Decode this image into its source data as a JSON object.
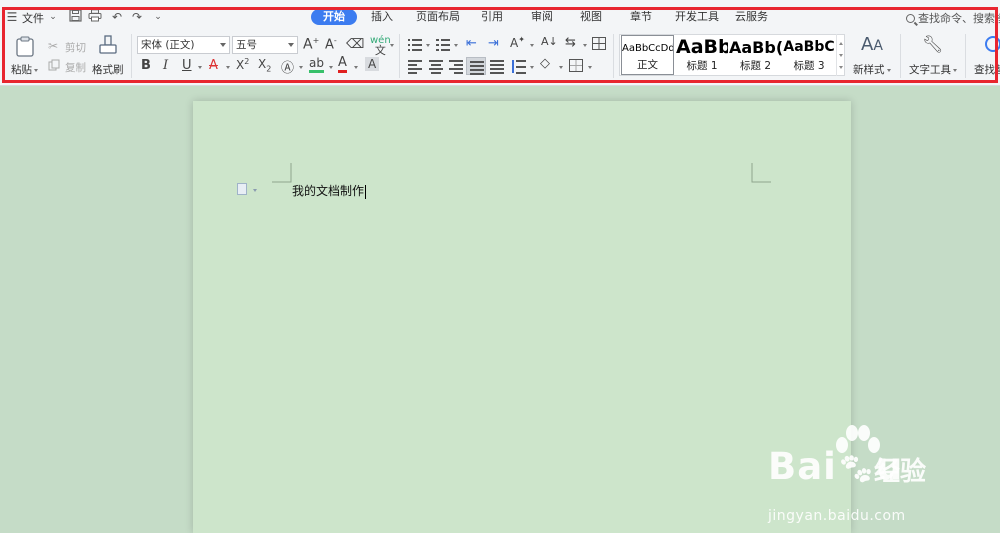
{
  "menu": {
    "file_label": "文件"
  },
  "tabs": [
    {
      "label": "开始",
      "active": true
    },
    {
      "label": "插入"
    },
    {
      "label": "页面布局"
    },
    {
      "label": "引用"
    },
    {
      "label": "审阅"
    },
    {
      "label": "视图"
    },
    {
      "label": "章节"
    },
    {
      "label": "开发工具"
    },
    {
      "label": "云服务"
    }
  ],
  "search": {
    "label": "查找命令、搜索模"
  },
  "clipboard": {
    "paste_label": "粘贴",
    "cut_label": "剪切",
    "copy_label": "复制",
    "format_painter_label": "格式刷"
  },
  "font": {
    "family_value": "宋体 (正文)",
    "size_value": "五号"
  },
  "styles": [
    {
      "sample": "AaBbCcDd",
      "name": "正文",
      "selected": true
    },
    {
      "sample": "AaBb",
      "name": "标题 1"
    },
    {
      "sample": "AaBb(",
      "name": "标题 2"
    },
    {
      "sample": "AaBbC",
      "name": "标题 3"
    }
  ],
  "ribbon_right": {
    "new_style_label": "新样式",
    "text_tools_label": "文字工具",
    "find_replace_label": "查找替"
  },
  "document": {
    "text": "我的文档制作"
  },
  "watermark": {
    "brand": "Bai",
    "brand_suffix": "u",
    "cn": "经验",
    "url": "jingyan.baidu.com"
  },
  "colors": {
    "accent": "#3c7cf0",
    "highlight_frame": "#e8252f",
    "page_bg": "#cde5cb",
    "workspace_bg": "#c5dcc7",
    "font_color_red": "#e02020",
    "highlight_green": "#37c06a"
  }
}
